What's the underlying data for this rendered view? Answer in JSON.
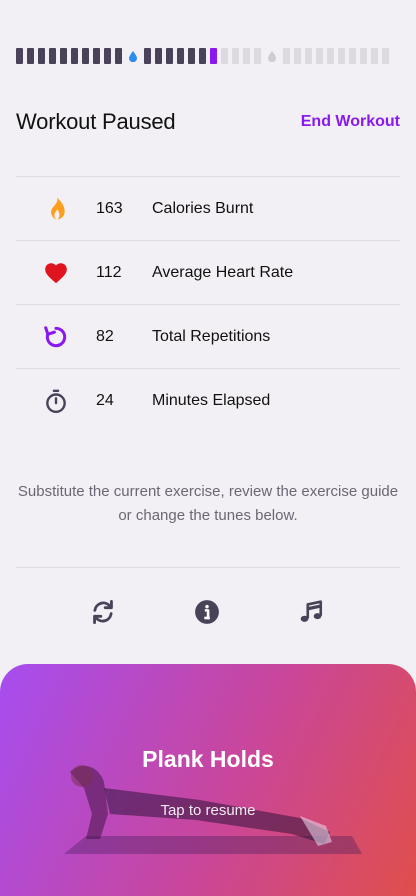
{
  "progress": {
    "segments_before_first_marker": 10,
    "segments_group_two_done": 6,
    "segments_group_two_todo": 4,
    "segments_group_three_todo": 10,
    "current_color": "#8a19f0",
    "done_color": "#4a4258",
    "todo_color": "#dcd9e1",
    "water_done_color": "#2d8cf0",
    "water_todo_color": "#cfcbd6"
  },
  "header": {
    "title": "Workout Paused",
    "end_label": "End Workout"
  },
  "stats": [
    {
      "icon": "flame-icon",
      "value": "163",
      "label": "Calories Burnt"
    },
    {
      "icon": "heart-icon",
      "value": "112",
      "label": "Average Heart Rate"
    },
    {
      "icon": "repeat-icon",
      "value": "82",
      "label": "Total Repetitions"
    },
    {
      "icon": "stopwatch-icon",
      "value": "24",
      "label": "Minutes Elapsed"
    }
  ],
  "helper_text": "Substitute the current exercise, review the exercise guide or change the tunes below.",
  "tools": [
    {
      "icon": "substitute-icon"
    },
    {
      "icon": "info-icon"
    },
    {
      "icon": "music-icon"
    }
  ],
  "resume": {
    "title": "Plank Holds",
    "subtitle": "Tap to resume"
  },
  "colors": {
    "accent": "#8a19f0",
    "flame": "#ff9d1c",
    "heart": "#e0141e"
  }
}
